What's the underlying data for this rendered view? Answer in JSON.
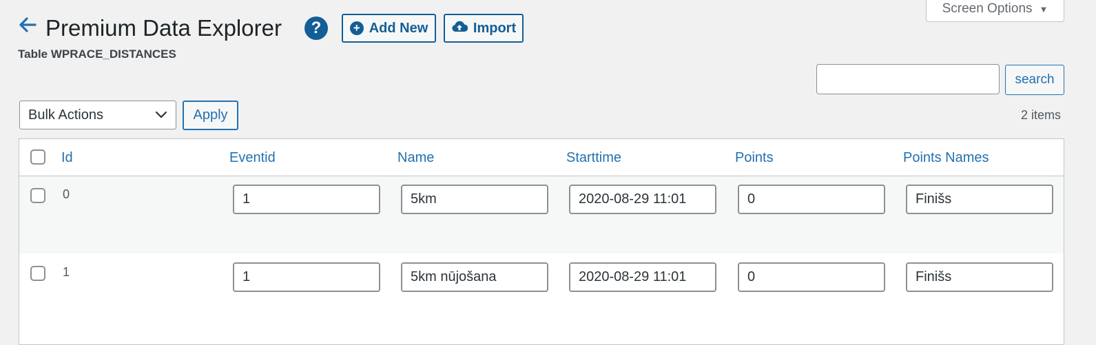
{
  "header": {
    "title": "Premium Data Explorer",
    "subtitle": "Table WPRACE_DISTANCES",
    "add_new_label": "Add New",
    "import_label": "Import",
    "help_glyph": "?",
    "add_glyph": "+"
  },
  "screen_options": {
    "label": "Screen Options",
    "caret": "▼"
  },
  "search": {
    "value": "",
    "button_label": "search"
  },
  "bulk": {
    "selected": "Bulk Actions",
    "apply_label": "Apply"
  },
  "items_count": "2 items",
  "table": {
    "columns": [
      "Id",
      "Eventid",
      "Name",
      "Starttime",
      "Points",
      "Points Names"
    ],
    "rows": [
      {
        "id": "0",
        "eventid": "1",
        "name": "5km",
        "starttime": "2020-08-29 11:01",
        "points": "0",
        "points_names": "Finišs"
      },
      {
        "id": "1",
        "eventid": "1",
        "name": "5km nūjošana",
        "starttime": "2020-08-29 11:01",
        "points": "0",
        "points_names": "Finišs"
      }
    ]
  },
  "colors": {
    "accent": "#2271b1",
    "accent_dark": "#135e96",
    "background": "#f1f1f1"
  },
  "icons": {
    "back": "arrow-left-icon",
    "help": "question-circle-icon",
    "add": "plus-circle-icon",
    "import": "cloud-upload-icon",
    "dropdown": "chevron-down-icon"
  }
}
